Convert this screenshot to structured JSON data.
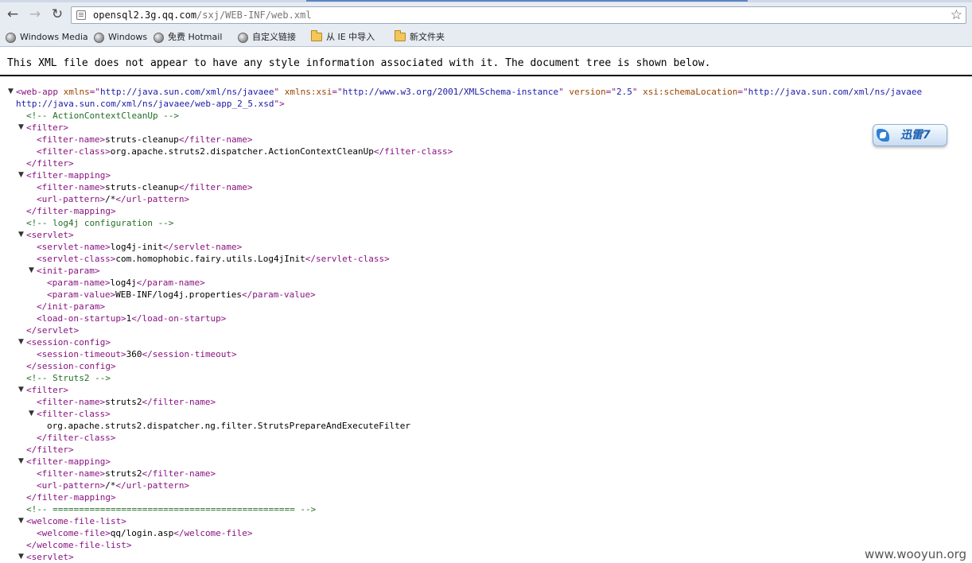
{
  "toolbar": {
    "back_icon": "←",
    "forward_icon": "→",
    "reload_icon": "↻",
    "url_host": "opensql2.3g.qq.com",
    "url_path": "/sxj/WEB-INF/web.xml",
    "star_icon": "☆"
  },
  "bookmarks": [
    {
      "label": "Windows Media",
      "icon": "globe-icon"
    },
    {
      "label": "Windows",
      "icon": "globe-icon"
    },
    {
      "label": "免费 Hotmail",
      "icon": "globe-icon"
    },
    {
      "label": "自定义链接",
      "icon": "globe-icon"
    },
    {
      "label": "从 IE 中导入",
      "icon": "folder-icon"
    },
    {
      "label": "新文件夹",
      "icon": "folder-icon"
    }
  ],
  "notice": "This XML file does not appear to have any style information associated with it. The document tree is shown below.",
  "colors": {
    "tag": "#881280",
    "attr_name": "#994500",
    "attr_value": "#1a1aa6",
    "comment": "#236e25"
  },
  "xml_lines": [
    {
      "indent": 0,
      "toggle": true,
      "tokens": [
        [
          "tg",
          "<web-app "
        ],
        [
          "an",
          "xmlns"
        ],
        [
          "tg",
          "=\""
        ],
        [
          "av",
          "http://java.sun.com/xml/ns/javaee"
        ],
        [
          "tg",
          "\" "
        ],
        [
          "an",
          "xmlns:xsi"
        ],
        [
          "tg",
          "=\""
        ],
        [
          "av",
          "http://www.w3.org/2001/XMLSchema-instance"
        ],
        [
          "tg",
          "\" "
        ],
        [
          "an",
          "version"
        ],
        [
          "tg",
          "=\""
        ],
        [
          "av",
          "2.5"
        ],
        [
          "tg",
          "\" "
        ],
        [
          "an",
          "xsi:schemaLocation"
        ],
        [
          "tg",
          "=\""
        ],
        [
          "av",
          "http://java.sun.com/xml/ns/javaee"
        ]
      ]
    },
    {
      "indent": 0,
      "wrap": true,
      "tokens": [
        [
          "av",
          "http://java.sun.com/xml/ns/javaee/web-app_2_5.xsd"
        ],
        [
          "tg",
          "\">"
        ]
      ]
    },
    {
      "indent": 1,
      "tokens": [
        [
          "cm",
          "<!-- ActionContextCleanUp -->"
        ]
      ]
    },
    {
      "indent": 1,
      "toggle": true,
      "tokens": [
        [
          "tg",
          "<filter>"
        ]
      ]
    },
    {
      "indent": 2,
      "tokens": [
        [
          "tg",
          "<filter-name>"
        ],
        [
          "tx",
          "struts-cleanup"
        ],
        [
          "tg",
          "</filter-name>"
        ]
      ]
    },
    {
      "indent": 2,
      "tokens": [
        [
          "tg",
          "<filter-class>"
        ],
        [
          "tx",
          "org.apache.struts2.dispatcher.ActionContextCleanUp"
        ],
        [
          "tg",
          "</filter-class>"
        ]
      ]
    },
    {
      "indent": 1,
      "tokens": [
        [
          "tg",
          "</filter>"
        ]
      ]
    },
    {
      "indent": 1,
      "toggle": true,
      "tokens": [
        [
          "tg",
          "<filter-mapping>"
        ]
      ]
    },
    {
      "indent": 2,
      "tokens": [
        [
          "tg",
          "<filter-name>"
        ],
        [
          "tx",
          "struts-cleanup"
        ],
        [
          "tg",
          "</filter-name>"
        ]
      ]
    },
    {
      "indent": 2,
      "tokens": [
        [
          "tg",
          "<url-pattern>"
        ],
        [
          "tx",
          "/*"
        ],
        [
          "tg",
          "</url-pattern>"
        ]
      ]
    },
    {
      "indent": 1,
      "tokens": [
        [
          "tg",
          "</filter-mapping>"
        ]
      ]
    },
    {
      "indent": 1,
      "tokens": [
        [
          "cm",
          "<!-- log4j configuration -->"
        ]
      ]
    },
    {
      "indent": 1,
      "toggle": true,
      "tokens": [
        [
          "tg",
          "<servlet>"
        ]
      ]
    },
    {
      "indent": 2,
      "tokens": [
        [
          "tg",
          "<servlet-name>"
        ],
        [
          "tx",
          "log4j-init"
        ],
        [
          "tg",
          "</servlet-name>"
        ]
      ]
    },
    {
      "indent": 2,
      "tokens": [
        [
          "tg",
          "<servlet-class>"
        ],
        [
          "tx",
          "com.homophobic.fairy.utils.Log4jInit"
        ],
        [
          "tg",
          "</servlet-class>"
        ]
      ]
    },
    {
      "indent": 2,
      "toggle": true,
      "tokens": [
        [
          "tg",
          "<init-param>"
        ]
      ]
    },
    {
      "indent": 3,
      "tokens": [
        [
          "tg",
          "<param-name>"
        ],
        [
          "tx",
          "log4j"
        ],
        [
          "tg",
          "</param-name>"
        ]
      ]
    },
    {
      "indent": 3,
      "tokens": [
        [
          "tg",
          "<param-value>"
        ],
        [
          "tx",
          "WEB-INF/log4j.properties"
        ],
        [
          "tg",
          "</param-value>"
        ]
      ]
    },
    {
      "indent": 2,
      "tokens": [
        [
          "tg",
          "</init-param>"
        ]
      ]
    },
    {
      "indent": 2,
      "tokens": [
        [
          "tg",
          "<load-on-startup>"
        ],
        [
          "tx",
          "1"
        ],
        [
          "tg",
          "</load-on-startup>"
        ]
      ]
    },
    {
      "indent": 1,
      "tokens": [
        [
          "tg",
          "</servlet>"
        ]
      ]
    },
    {
      "indent": 1,
      "toggle": true,
      "tokens": [
        [
          "tg",
          "<session-config>"
        ]
      ]
    },
    {
      "indent": 2,
      "tokens": [
        [
          "tg",
          "<session-timeout>"
        ],
        [
          "tx",
          "360"
        ],
        [
          "tg",
          "</session-timeout>"
        ]
      ]
    },
    {
      "indent": 1,
      "tokens": [
        [
          "tg",
          "</session-config>"
        ]
      ]
    },
    {
      "indent": 1,
      "tokens": [
        [
          "cm",
          "<!-- Struts2 -->"
        ]
      ]
    },
    {
      "indent": 1,
      "toggle": true,
      "tokens": [
        [
          "tg",
          "<filter>"
        ]
      ]
    },
    {
      "indent": 2,
      "tokens": [
        [
          "tg",
          "<filter-name>"
        ],
        [
          "tx",
          "struts2"
        ],
        [
          "tg",
          "</filter-name>"
        ]
      ]
    },
    {
      "indent": 2,
      "toggle": true,
      "tokens": [
        [
          "tg",
          "<filter-class>"
        ]
      ]
    },
    {
      "indent": 3,
      "tokens": [
        [
          "tx",
          "org.apache.struts2.dispatcher.ng.filter.StrutsPrepareAndExecuteFilter"
        ]
      ]
    },
    {
      "indent": 2,
      "tokens": [
        [
          "tg",
          "</filter-class>"
        ]
      ]
    },
    {
      "indent": 1,
      "tokens": [
        [
          "tg",
          "</filter>"
        ]
      ]
    },
    {
      "indent": 1,
      "toggle": true,
      "tokens": [
        [
          "tg",
          "<filter-mapping>"
        ]
      ]
    },
    {
      "indent": 2,
      "tokens": [
        [
          "tg",
          "<filter-name>"
        ],
        [
          "tx",
          "struts2"
        ],
        [
          "tg",
          "</filter-name>"
        ]
      ]
    },
    {
      "indent": 2,
      "tokens": [
        [
          "tg",
          "<url-pattern>"
        ],
        [
          "tx",
          "/*"
        ],
        [
          "tg",
          "</url-pattern>"
        ]
      ]
    },
    {
      "indent": 1,
      "tokens": [
        [
          "tg",
          "</filter-mapping>"
        ]
      ]
    },
    {
      "indent": 1,
      "tokens": [
        [
          "cm",
          "<!-- ============================================== -->"
        ]
      ]
    },
    {
      "indent": 1,
      "toggle": true,
      "tokens": [
        [
          "tg",
          "<welcome-file-list>"
        ]
      ]
    },
    {
      "indent": 2,
      "tokens": [
        [
          "tg",
          "<welcome-file>"
        ],
        [
          "tx",
          "qq/login.asp"
        ],
        [
          "tg",
          "</welcome-file>"
        ]
      ]
    },
    {
      "indent": 1,
      "tokens": [
        [
          "tg",
          "</welcome-file-list>"
        ]
      ]
    },
    {
      "indent": 1,
      "toggle": true,
      "tokens": [
        [
          "tg",
          "<servlet>"
        ]
      ]
    }
  ],
  "xunlei_label": "迅雷7",
  "watermark": "www.wooyun.org"
}
